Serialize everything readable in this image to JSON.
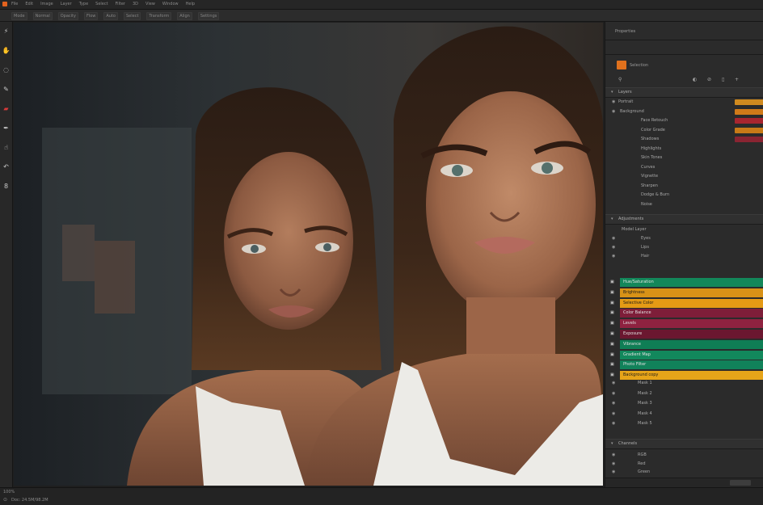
{
  "menu": {
    "items": [
      "File",
      "Edit",
      "Image",
      "Layer",
      "Type",
      "Select",
      "Filter",
      "3D",
      "View",
      "Window",
      "Help"
    ]
  },
  "options": {
    "items": [
      "Mode",
      "Normal",
      "Opacity",
      "Flow",
      "Auto",
      "Select",
      "Transform",
      "Align",
      "Settings"
    ]
  },
  "tools": [
    {
      "icon": "wand-icon",
      "glyph": "⚡"
    },
    {
      "icon": "hand-icon",
      "glyph": "✋"
    },
    {
      "icon": "lasso-icon",
      "glyph": "◌"
    },
    {
      "icon": "brush-icon",
      "glyph": "✎"
    },
    {
      "icon": "eraser-icon",
      "glyph": "▰"
    },
    {
      "icon": "pen-icon",
      "glyph": "✒"
    },
    {
      "icon": "smudge-icon",
      "glyph": "☝"
    },
    {
      "icon": "history-icon",
      "glyph": "↶"
    },
    {
      "icon": "type-icon",
      "glyph": "8"
    }
  ],
  "panel": {
    "tab": "Properties",
    "swatch_label": "Selection",
    "swatch_color": "#e0711d",
    "section1": "Layers",
    "section2": "Adjustments",
    "layers_top": [
      {
        "label": "Portrait",
        "indent": 16,
        "chip": "#d08a1f"
      },
      {
        "label": "Background",
        "indent": 18,
        "chip": "#d07a19"
      },
      {
        "label": "Face Retouch",
        "indent": 44,
        "chip": "#a8252f"
      },
      {
        "label": "Color Grade",
        "indent": 44,
        "chip": "#c87a17"
      },
      {
        "label": "Shadows",
        "indent": 44,
        "chip": "#8a2432"
      },
      {
        "label": "Highlights",
        "indent": 44,
        "chip": ""
      },
      {
        "label": "Skin Tones",
        "indent": 44,
        "chip": ""
      },
      {
        "label": "Curves",
        "indent": 44,
        "chip": ""
      },
      {
        "label": "Vignette",
        "indent": 44,
        "chip": ""
      },
      {
        "label": "Sharpen",
        "indent": 44,
        "chip": ""
      },
      {
        "label": "Dodge & Burn",
        "indent": 44,
        "chip": ""
      },
      {
        "label": "Noise",
        "indent": 44,
        "chip": ""
      }
    ],
    "layers_mid": [
      {
        "label": "Model Layer",
        "indent": 20
      },
      {
        "label": "Eyes",
        "indent": 44
      },
      {
        "label": "Lips",
        "indent": 44
      },
      {
        "label": "Hair",
        "indent": 44
      }
    ],
    "colored_layers": [
      {
        "label": "Hue/Saturation",
        "color": "#13875a",
        "dark": true
      },
      {
        "label": "Brightness",
        "color": "#d89217",
        "dark": false
      },
      {
        "label": "Selective Color",
        "color": "#e59a15",
        "dark": false
      },
      {
        "label": "Color Balance",
        "color": "#7e1e39",
        "dark": true
      },
      {
        "label": "Levels",
        "color": "#8f2240",
        "dark": true
      },
      {
        "label": "Exposure",
        "color": "#6b1730",
        "dark": true
      },
      {
        "label": "Vibrance",
        "color": "#0f7e55",
        "dark": true
      },
      {
        "label": "Gradient Map",
        "color": "#12885c",
        "dark": true
      },
      {
        "label": "Photo Filter",
        "color": "#11825a",
        "dark": true
      },
      {
        "label": "Background copy",
        "color": "#e6a419",
        "dark": false
      }
    ],
    "layers_bottom": [
      {
        "label": "Mask 1",
        "indent": 20
      },
      {
        "label": "Mask 2",
        "indent": 20
      },
      {
        "label": "Mask 3",
        "indent": 20
      },
      {
        "label": "Mask 4",
        "indent": 20
      },
      {
        "label": "Mask 5",
        "indent": 20
      }
    ],
    "section3": "Channels",
    "channel_rows": [
      "RGB",
      "Red",
      "Green"
    ]
  },
  "status": {
    "zoom": "100%",
    "info": "Doc: 24.5M/98.2M"
  }
}
